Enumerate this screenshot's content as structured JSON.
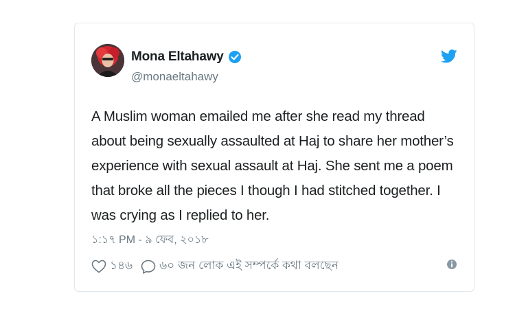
{
  "author": {
    "display_name": "Mona Eltahawy",
    "handle": "@monaeltahawy",
    "verified": true
  },
  "tweet": {
    "text": "A Muslim woman emailed me after she read my thread\nabout being sexually assaulted at Haj to share her mother’s\nexperience with sexual assault at Haj. She sent me a poem\nthat broke all the pieces I though I had stitched together. I\nwas crying as I replied to her.",
    "timestamp": "১:১৭ PM - ৯ ফেব, ২০১৮"
  },
  "actions": {
    "likes_count": "১৪৬",
    "reply_text": "৬০ জন লোক এই সম্পর্কে কথা বলছেন"
  },
  "icons": {
    "brand": "twitter-bird-icon",
    "verified": "verified-badge-icon",
    "like": "heart-icon",
    "reply": "speech-bubble-icon",
    "info": "info-icon"
  },
  "colors": {
    "brand_blue": "#1da1f2",
    "text": "#1c2022",
    "secondary_text": "#697882",
    "border": "#e1e8ed"
  }
}
